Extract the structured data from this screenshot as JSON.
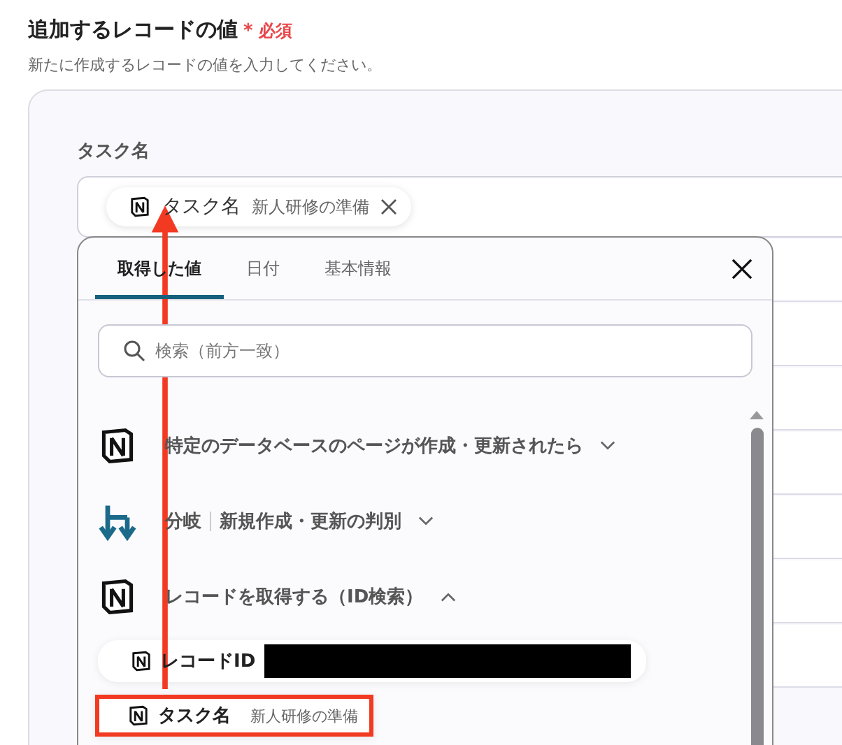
{
  "section": {
    "title": "追加するレコードの値",
    "required_mark": "*",
    "required_label": "必須",
    "description": "新たに作成するレコードの値を入力してください。"
  },
  "field": {
    "label": "タスク名",
    "chip": {
      "name": "タスク名",
      "value": "新人研修の準備"
    }
  },
  "panel": {
    "tabs": [
      {
        "label": "取得した値",
        "selected": true
      },
      {
        "label": "日付",
        "selected": false
      },
      {
        "label": "基本情報",
        "selected": false
      }
    ],
    "search": {
      "placeholder": "検索（前方一致）"
    },
    "groups": [
      {
        "kind": "notion",
        "title": "特定のデータベースのページが作成・更新されたら",
        "expanded": false
      },
      {
        "kind": "branch",
        "title": "分岐",
        "subtitle": "新規作成・更新の判別",
        "expanded": false
      },
      {
        "kind": "notion",
        "title": "レコードを取得する（ID検索）",
        "expanded": true,
        "items": [
          {
            "name": "レコードID",
            "redacted": true,
            "highlighted": false
          },
          {
            "name": "タスク名",
            "value": "新人研修の準備",
            "redacted": false,
            "highlighted": true
          }
        ]
      }
    ]
  }
}
